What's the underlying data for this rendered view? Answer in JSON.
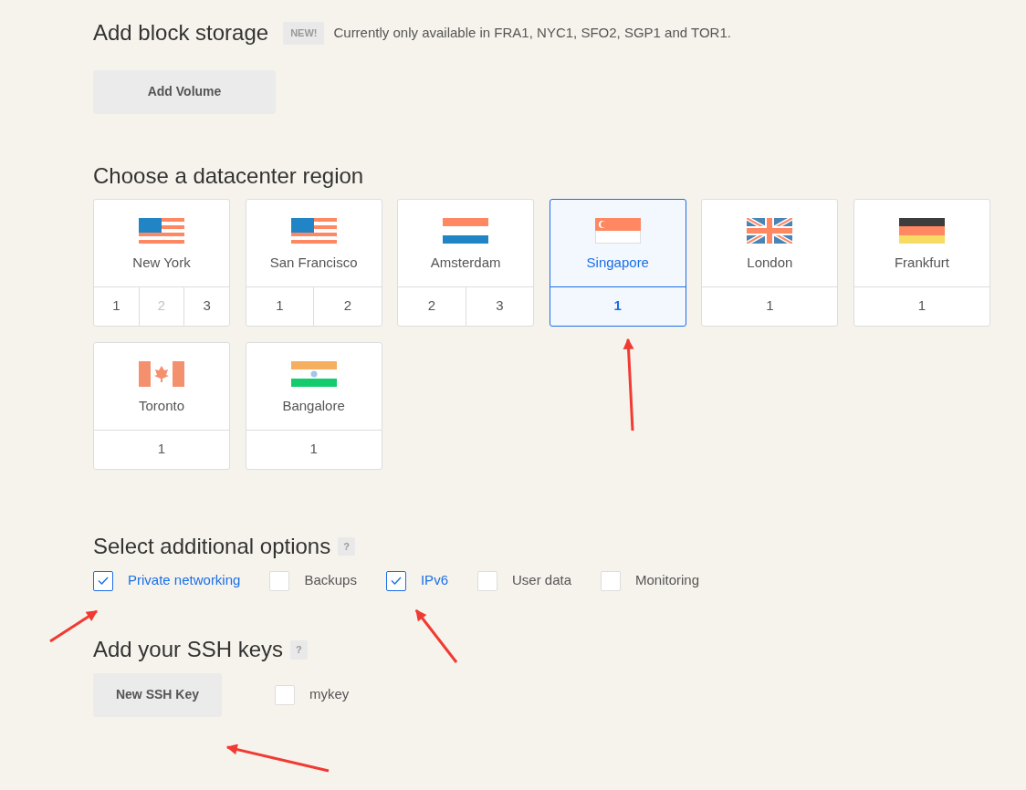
{
  "block_storage": {
    "title": "Add block storage",
    "badge": "NEW!",
    "note": "Currently only available in FRA1, NYC1, SFO2, SGP1 and TOR1.",
    "button": "Add Volume"
  },
  "datacenter": {
    "title": "Choose a datacenter region",
    "regions": [
      {
        "kind": "us",
        "name": "New York",
        "selected": false,
        "numbers": [
          {
            "label": "1",
            "disabled": false,
            "selected": false
          },
          {
            "label": "2",
            "disabled": true,
            "selected": false
          },
          {
            "label": "3",
            "disabled": false,
            "selected": false
          }
        ]
      },
      {
        "kind": "us",
        "name": "San Francisco",
        "selected": false,
        "numbers": [
          {
            "label": "1",
            "disabled": false,
            "selected": false
          },
          {
            "label": "2",
            "disabled": false,
            "selected": false
          }
        ]
      },
      {
        "kind": "nl",
        "name": "Amsterdam",
        "selected": false,
        "numbers": [
          {
            "label": "2",
            "disabled": false,
            "selected": false
          },
          {
            "label": "3",
            "disabled": false,
            "selected": false
          }
        ]
      },
      {
        "kind": "sg",
        "name": "Singapore",
        "selected": true,
        "numbers": [
          {
            "label": "1",
            "disabled": false,
            "selected": true
          }
        ]
      },
      {
        "kind": "gb",
        "name": "London",
        "selected": false,
        "numbers": [
          {
            "label": "1",
            "disabled": false,
            "selected": false
          }
        ]
      },
      {
        "kind": "de",
        "name": "Frankfurt",
        "selected": false,
        "numbers": [
          {
            "label": "1",
            "disabled": false,
            "selected": false
          }
        ]
      },
      {
        "kind": "ca",
        "name": "Toronto",
        "selected": false,
        "numbers": [
          {
            "label": "1",
            "disabled": false,
            "selected": false
          }
        ]
      },
      {
        "kind": "in",
        "name": "Bangalore",
        "selected": false,
        "numbers": [
          {
            "label": "1",
            "disabled": false,
            "selected": false
          }
        ]
      }
    ]
  },
  "options": {
    "title": "Select additional options",
    "help": "?",
    "items": [
      {
        "label": "Private networking",
        "checked": true
      },
      {
        "label": "Backups",
        "checked": false
      },
      {
        "label": "IPv6",
        "checked": true
      },
      {
        "label": "User data",
        "checked": false
      },
      {
        "label": "Monitoring",
        "checked": false
      }
    ]
  },
  "ssh": {
    "title": "Add your SSH keys",
    "help": "?",
    "button": "New SSH Key",
    "keys": [
      {
        "label": "mykey",
        "checked": false
      }
    ]
  }
}
